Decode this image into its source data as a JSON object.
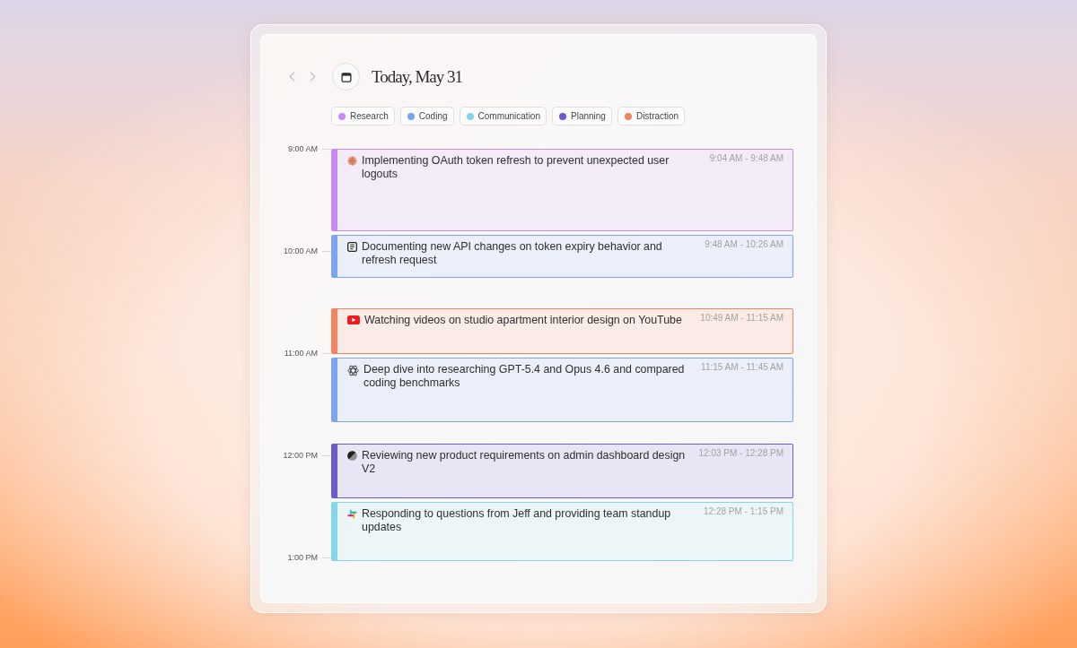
{
  "header": {
    "title": "Today, May 31"
  },
  "categories": [
    {
      "label": "Research",
      "color": "#c58af5"
    },
    {
      "label": "Coding",
      "color": "#7ca3f5"
    },
    {
      "label": "Communication",
      "color": "#84d6e8"
    },
    {
      "label": "Planning",
      "color": "#6a5bcf"
    },
    {
      "label": "Distraction",
      "color": "#f4845f"
    }
  ],
  "timeline": {
    "hours": [
      "9:00 AM",
      "10:00 AM",
      "11:00 AM",
      "12:00 PM",
      "1:00 PM"
    ],
    "events": [
      {
        "title": "Implementing OAuth token refresh to prevent unexpected user logouts",
        "time": "9:04 AM - 9:48 AM",
        "color": "#c58af5"
      },
      {
        "title": "Documenting new API changes on token expiry behavior and refresh request",
        "time": "9:48 AM - 10:26 AM",
        "color": "#7ca3f5"
      },
      {
        "title": "Watching videos on studio apartment interior design on YouTube",
        "time": "10:49 AM - 11:15 AM",
        "color": "#f4845f"
      },
      {
        "title": "Deep dive into researching GPT-5.4 and Opus 4.6 and compared coding benchmarks",
        "time": "11:15 AM - 11:45 AM",
        "color": "#7ca3f5"
      },
      {
        "title": "Reviewing new product requirements on admin dashboard design V2",
        "time": "12:03 PM - 12:28 PM",
        "color": "#6a5bcf"
      },
      {
        "title": "Responding to questions from Jeff and providing team standup updates",
        "time": "12:28 PM - 1:15 PM",
        "color": "#84d6e8"
      }
    ]
  }
}
